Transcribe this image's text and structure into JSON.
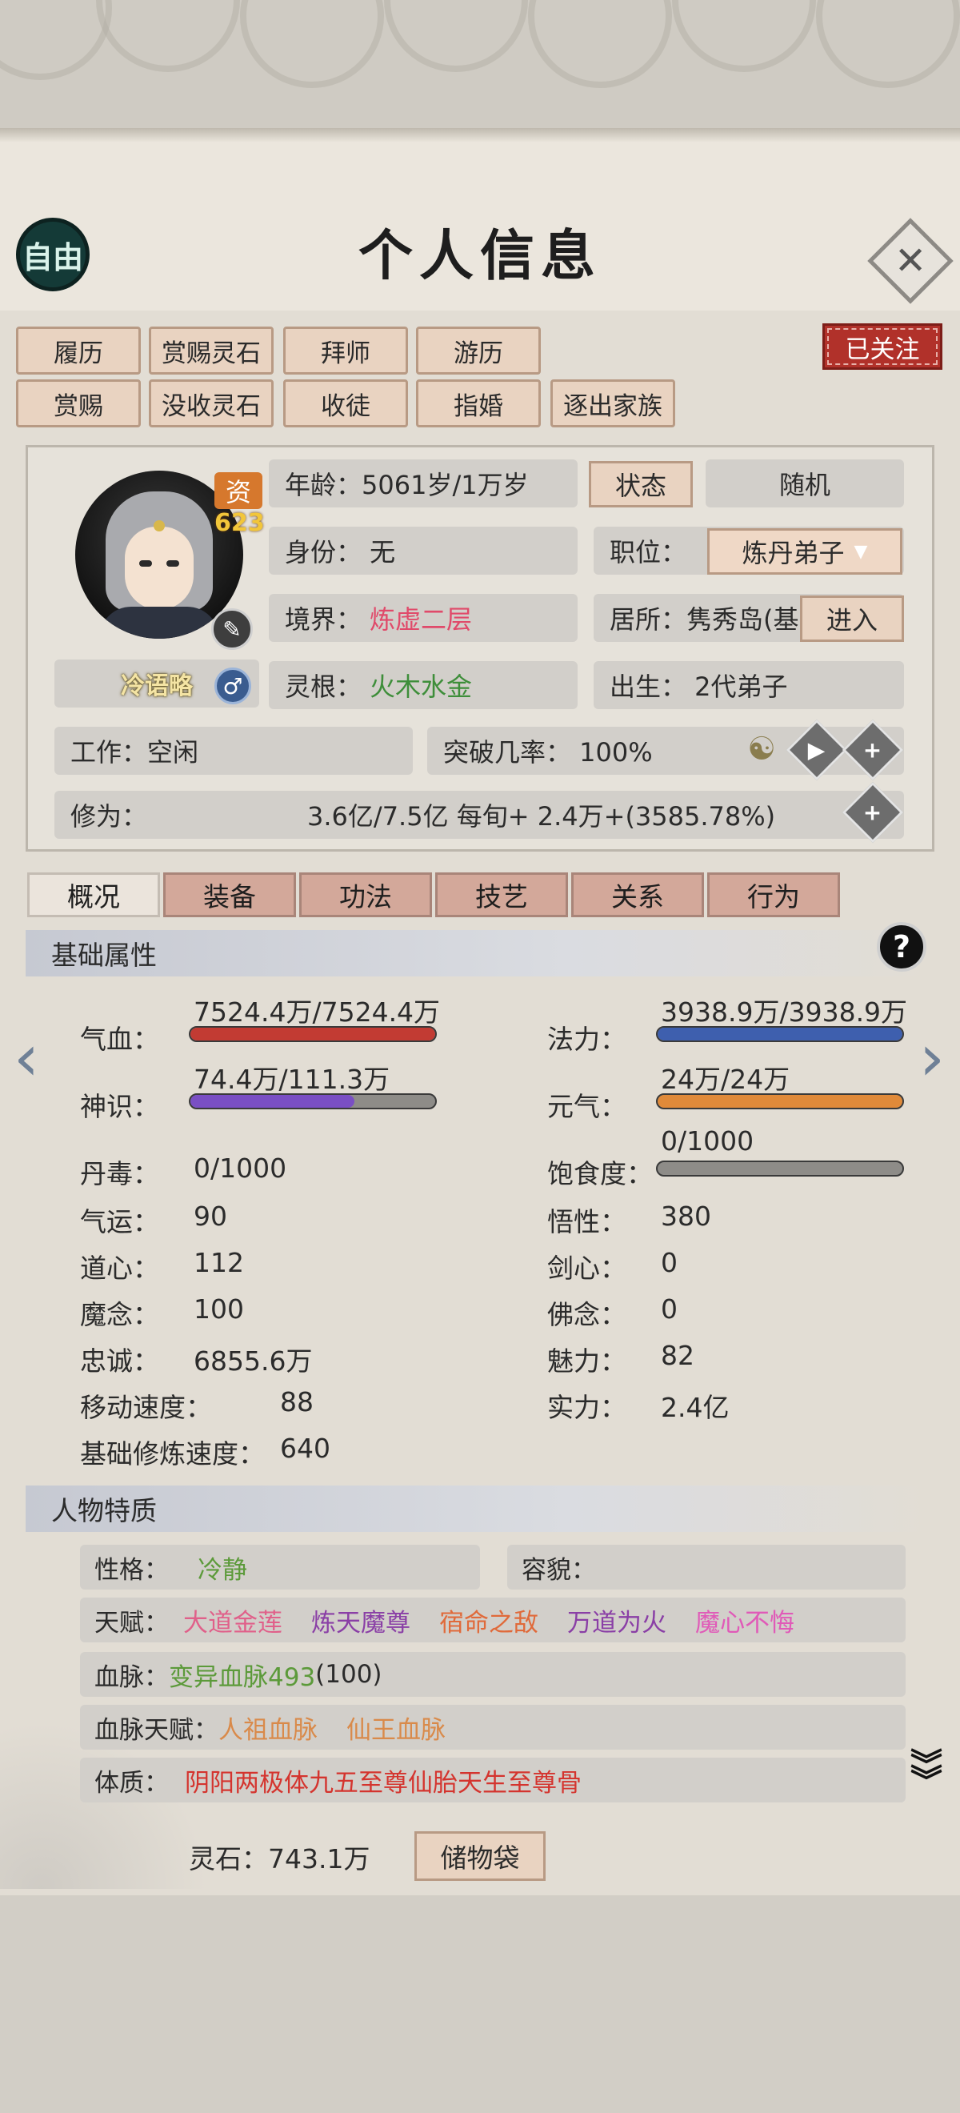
{
  "header": {
    "free_label": "自由",
    "title": "个人信息"
  },
  "actions_row1": [
    "履历",
    "赏赐灵石",
    "拜师",
    "游历"
  ],
  "actions_row2": [
    "赏赐",
    "没收灵石",
    "收徒",
    "指婚",
    "逐出家族"
  ],
  "followed_label": "已关注",
  "character": {
    "talent_char": "资",
    "talent_value": "623",
    "name": "冷语略",
    "gender_symbol": "♂",
    "age": "年龄：5061岁/1万岁",
    "status_btn": "状态",
    "random_btn": "随机",
    "identity": "身份：  无",
    "position_label": "职位：",
    "position_value": "炼丹弟子",
    "realm_label": "境界：",
    "realm_value": "炼虚二层",
    "residence": "居所：隽秀岛(基",
    "enter_btn": "进入",
    "root_label": "灵根：",
    "root_value": "火木水金",
    "birth": "出生：  2代弟子",
    "work": "工作：空闲",
    "breakthrough": "突破几率：  100%",
    "cultivation_label": "修为：",
    "cultivation_value": "3.6亿/7.5亿  每旬+  2.4万+(3585.78%)"
  },
  "tabs": [
    "概况",
    "装备",
    "功法",
    "技艺",
    "关系",
    "行为"
  ],
  "basic": {
    "heading": "基础属性",
    "qixue_label": "气血：",
    "qixue_value": "7524.4万/7524.4万",
    "qixue_fraction": 1.0,
    "fali_label": "法力：",
    "fali_value": "3938.9万/3938.9万",
    "fali_fraction": 1.0,
    "shenshi_label": "神识：",
    "shenshi_value": "74.4万/111.3万",
    "shenshi_fraction": 0.67,
    "yuanqi_label": "元气：",
    "yuanqi_value": "24万/24万",
    "yuanqi_fraction": 1.0,
    "dandu_label": "丹毒：",
    "dandu_value": "0/1000",
    "baoshi_label": "饱食度：",
    "baoshi_value": "0/1000",
    "baoshi_fraction": 0.0,
    "left_stats": [
      {
        "label": "气运：",
        "value": "90"
      },
      {
        "label": "道心：",
        "value": "112"
      },
      {
        "label": "魔念：",
        "value": "100"
      },
      {
        "label": "忠诚：",
        "value": "6855.6万"
      },
      {
        "label": "移动速度：",
        "value": "88"
      },
      {
        "label": "基础修炼速度：",
        "value": "640"
      }
    ],
    "right_stats": [
      {
        "label": "悟性：",
        "value": "380"
      },
      {
        "label": "剑心：",
        "value": "0"
      },
      {
        "label": "佛念：",
        "value": "0"
      },
      {
        "label": "魅力：",
        "value": "82"
      },
      {
        "label": "实力：",
        "value": "2.4亿"
      }
    ]
  },
  "traits": {
    "heading": "人物特质",
    "personality_label": "性格：",
    "personality_value": "冷静",
    "looks_label": "容貌：",
    "talent_label": "天赋：",
    "talents": [
      "大道金莲",
      "炼天魔尊",
      "宿命之敌",
      "万道为火",
      "魔心不悔"
    ],
    "blood_label": "血脉：",
    "blood_value": "变异血脉493",
    "blood_extra": "(100)",
    "blood_talent_label": "血脉天赋：",
    "blood_talents": [
      "人祖血脉",
      "仙王血脉"
    ],
    "body_label": "体质：",
    "body_value": "阴阳两极体九五至尊仙胎天生至尊骨"
  },
  "footer": {
    "stones": "灵石：743.1万",
    "bag_btn": "储物袋"
  },
  "colors": {
    "hp": "#c23b33",
    "mp": "#3e5fae",
    "mind": "#7a4fc4",
    "qi": "#e08a3a"
  }
}
